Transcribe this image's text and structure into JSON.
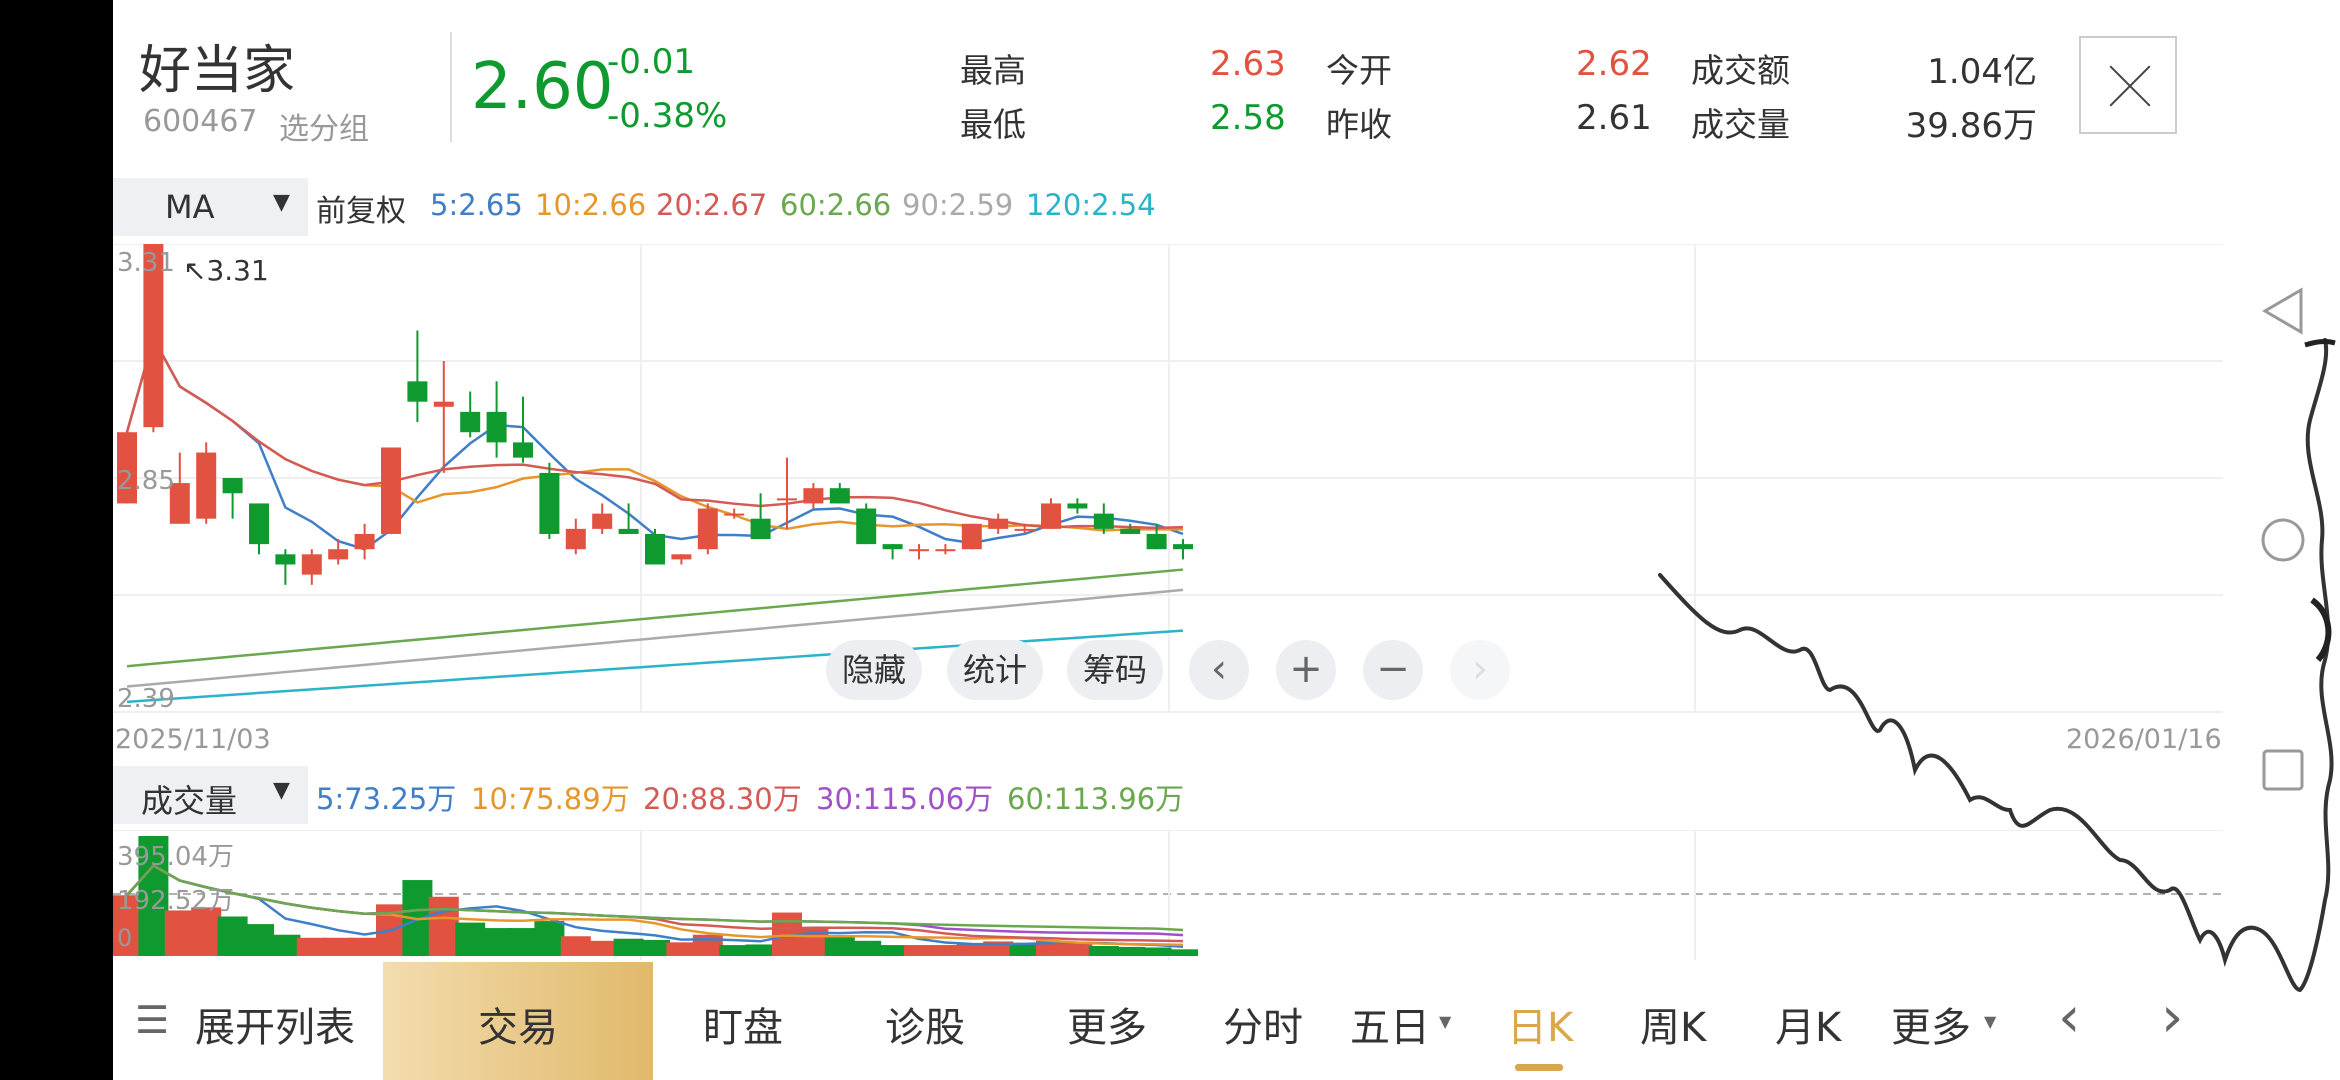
{
  "stock": {
    "name": "好当家",
    "code": "600467",
    "group_link": "选分组",
    "price": "2.60",
    "change": "-0.01",
    "change_pct": "-0.38%"
  },
  "quote": {
    "high_label": "最高",
    "high": "2.63",
    "low_label": "最低",
    "low": "2.58",
    "open_label": "今开",
    "open": "2.62",
    "prev_close_label": "昨收",
    "prev_close": "2.61",
    "amount_label": "成交额",
    "amount": "1.04亿",
    "volume_label": "成交量",
    "volume": "39.86万"
  },
  "ma_bar": {
    "selector": "MA",
    "adjust": "前复权",
    "ma5": "5:2.65",
    "ma10": "10:2.66",
    "ma20": "20:2.67",
    "ma60": "60:2.66",
    "ma90": "90:2.59",
    "ma120": "120:2.54"
  },
  "vol_bar": {
    "selector": "成交量",
    "v5": "5:73.25万",
    "v10": "10:75.89万",
    "v20": "20:88.30万",
    "v30": "30:115.06万",
    "v60": "60:113.96万"
  },
  "chart_labels": {
    "y_top": "3.31",
    "max_marker": "3.31",
    "y_mid": "2.85",
    "y_low": "2.39",
    "date_start": "2025/11/03",
    "date_end": "2026/01/16",
    "vol_top": "395.04万",
    "vol_mid": "192.52万",
    "vol_zero": "0"
  },
  "chart_buttons": {
    "hide": "隐藏",
    "stats": "统计",
    "chips": "筹码",
    "prev": "‹",
    "zoom_in": "+",
    "zoom_out": "−",
    "next": "›"
  },
  "tabbar": {
    "expand": "展开列表",
    "trade": "交易",
    "watch": "盯盘",
    "diagnose": "诊股",
    "more1": "更多",
    "intraday": "分时",
    "five_day": "五日",
    "daily": "日K",
    "weekly": "周K",
    "monthly": "月K",
    "more2": "更多",
    "prev": "‹",
    "next": "›"
  },
  "colors": {
    "up": "#e15241",
    "down": "#0f9a2f",
    "ma5": "#3f7fc8",
    "ma10": "#e7962c",
    "ma20": "#d45a55",
    "ma60": "#6aa84f",
    "ma90": "#aaaaaa",
    "ma120": "#2ab3c9",
    "v30": "#a050c8",
    "accent": "#d9a84a"
  },
  "chart_data": {
    "type": "candlestick",
    "ylim": [
      2.39,
      3.31
    ],
    "candles": [
      {
        "o": 2.8,
        "c": 2.94,
        "h": 2.94,
        "l": 2.8
      },
      {
        "o": 2.95,
        "c": 3.31,
        "h": 3.31,
        "l": 2.94
      },
      {
        "o": 2.76,
        "c": 2.84,
        "h": 2.9,
        "l": 2.76
      },
      {
        "o": 2.77,
        "c": 2.9,
        "h": 2.92,
        "l": 2.76
      },
      {
        "o": 2.85,
        "c": 2.82,
        "h": 2.85,
        "l": 2.77
      },
      {
        "o": 2.8,
        "c": 2.72,
        "h": 2.8,
        "l": 2.7
      },
      {
        "o": 2.7,
        "c": 2.68,
        "h": 2.71,
        "l": 2.64
      },
      {
        "o": 2.66,
        "c": 2.7,
        "h": 2.71,
        "l": 2.64
      },
      {
        "o": 2.69,
        "c": 2.71,
        "h": 2.73,
        "l": 2.68
      },
      {
        "o": 2.71,
        "c": 2.74,
        "h": 2.76,
        "l": 2.69
      },
      {
        "o": 2.74,
        "c": 2.91,
        "h": 2.91,
        "l": 2.74
      },
      {
        "o": 3.04,
        "c": 3.0,
        "h": 3.14,
        "l": 2.96
      },
      {
        "o": 2.99,
        "c": 3.0,
        "h": 3.08,
        "l": 2.86
      },
      {
        "o": 2.98,
        "c": 2.94,
        "h": 3.02,
        "l": 2.93
      },
      {
        "o": 2.98,
        "c": 2.92,
        "h": 3.04,
        "l": 2.89
      },
      {
        "o": 2.92,
        "c": 2.89,
        "h": 3.01,
        "l": 2.88
      },
      {
        "o": 2.86,
        "c": 2.74,
        "h": 2.88,
        "l": 2.73
      },
      {
        "o": 2.71,
        "c": 2.75,
        "h": 2.77,
        "l": 2.7
      },
      {
        "o": 2.75,
        "c": 2.78,
        "h": 2.8,
        "l": 2.74
      },
      {
        "o": 2.75,
        "c": 2.74,
        "h": 2.8,
        "l": 2.74
      },
      {
        "o": 2.74,
        "c": 2.68,
        "h": 2.75,
        "l": 2.68
      },
      {
        "o": 2.69,
        "c": 2.7,
        "h": 2.7,
        "l": 2.68
      },
      {
        "o": 2.71,
        "c": 2.79,
        "h": 2.8,
        "l": 2.7
      },
      {
        "o": 2.78,
        "c": 2.78,
        "h": 2.79,
        "l": 2.77
      },
      {
        "o": 2.77,
        "c": 2.73,
        "h": 2.82,
        "l": 2.73
      },
      {
        "o": 2.81,
        "c": 2.81,
        "h": 2.89,
        "l": 2.75
      },
      {
        "o": 2.8,
        "c": 2.83,
        "h": 2.84,
        "l": 2.79
      },
      {
        "o": 2.83,
        "c": 2.8,
        "h": 2.84,
        "l": 2.8
      },
      {
        "o": 2.79,
        "c": 2.72,
        "h": 2.8,
        "l": 2.72
      },
      {
        "o": 2.72,
        "c": 2.71,
        "h": 2.72,
        "l": 2.69
      },
      {
        "o": 2.71,
        "c": 2.71,
        "h": 2.72,
        "l": 2.69
      },
      {
        "o": 2.71,
        "c": 2.71,
        "h": 2.72,
        "l": 2.7
      },
      {
        "o": 2.71,
        "c": 2.76,
        "h": 2.76,
        "l": 2.71
      },
      {
        "o": 2.75,
        "c": 2.77,
        "h": 2.78,
        "l": 2.74
      },
      {
        "o": 2.75,
        "c": 2.75,
        "h": 2.76,
        "l": 2.74
      },
      {
        "o": 2.75,
        "c": 2.8,
        "h": 2.81,
        "l": 2.75
      },
      {
        "o": 2.8,
        "c": 2.79,
        "h": 2.81,
        "l": 2.78
      },
      {
        "o": 2.78,
        "c": 2.75,
        "h": 2.8,
        "l": 2.74
      },
      {
        "o": 2.75,
        "c": 2.74,
        "h": 2.76,
        "l": 2.74
      },
      {
        "o": 2.74,
        "c": 2.71,
        "h": 2.76,
        "l": 2.71
      },
      {
        "o": 2.72,
        "c": 2.71,
        "h": 2.73,
        "l": 2.69
      }
    ],
    "volume": [
      {
        "v": 200,
        "up": true
      },
      {
        "v": 395.04,
        "up": false
      },
      {
        "v": 150,
        "up": true
      },
      {
        "v": 160,
        "up": true
      },
      {
        "v": 130,
        "up": false
      },
      {
        "v": 105,
        "up": false
      },
      {
        "v": 70,
        "up": false
      },
      {
        "v": 60,
        "up": true
      },
      {
        "v": 60,
        "up": true
      },
      {
        "v": 60,
        "up": true
      },
      {
        "v": 170,
        "up": true
      },
      {
        "v": 250,
        "up": false
      },
      {
        "v": 195,
        "up": true
      },
      {
        "v": 110,
        "up": false
      },
      {
        "v": 92,
        "up": false
      },
      {
        "v": 92,
        "up": false
      },
      {
        "v": 115,
        "up": false
      },
      {
        "v": 65,
        "up": true
      },
      {
        "v": 50,
        "up": true
      },
      {
        "v": 57,
        "up": false
      },
      {
        "v": 53,
        "up": false
      },
      {
        "v": 45,
        "up": true
      },
      {
        "v": 70,
        "up": true
      },
      {
        "v": 36,
        "up": false
      },
      {
        "v": 38,
        "up": false
      },
      {
        "v": 143,
        "up": true
      },
      {
        "v": 95,
        "up": true
      },
      {
        "v": 65,
        "up": false
      },
      {
        "v": 50,
        "up": false
      },
      {
        "v": 36,
        "up": false
      },
      {
        "v": 36,
        "up": true
      },
      {
        "v": 36,
        "up": true
      },
      {
        "v": 40,
        "up": true
      },
      {
        "v": 48,
        "up": true
      },
      {
        "v": 40,
        "up": false
      },
      {
        "v": 50,
        "up": true
      },
      {
        "v": 40,
        "up": true
      },
      {
        "v": 33,
        "up": false
      },
      {
        "v": 30,
        "up": false
      },
      {
        "v": 28,
        "up": false
      },
      {
        "v": 22,
        "up": false
      }
    ],
    "vol_max": 395.04
  }
}
